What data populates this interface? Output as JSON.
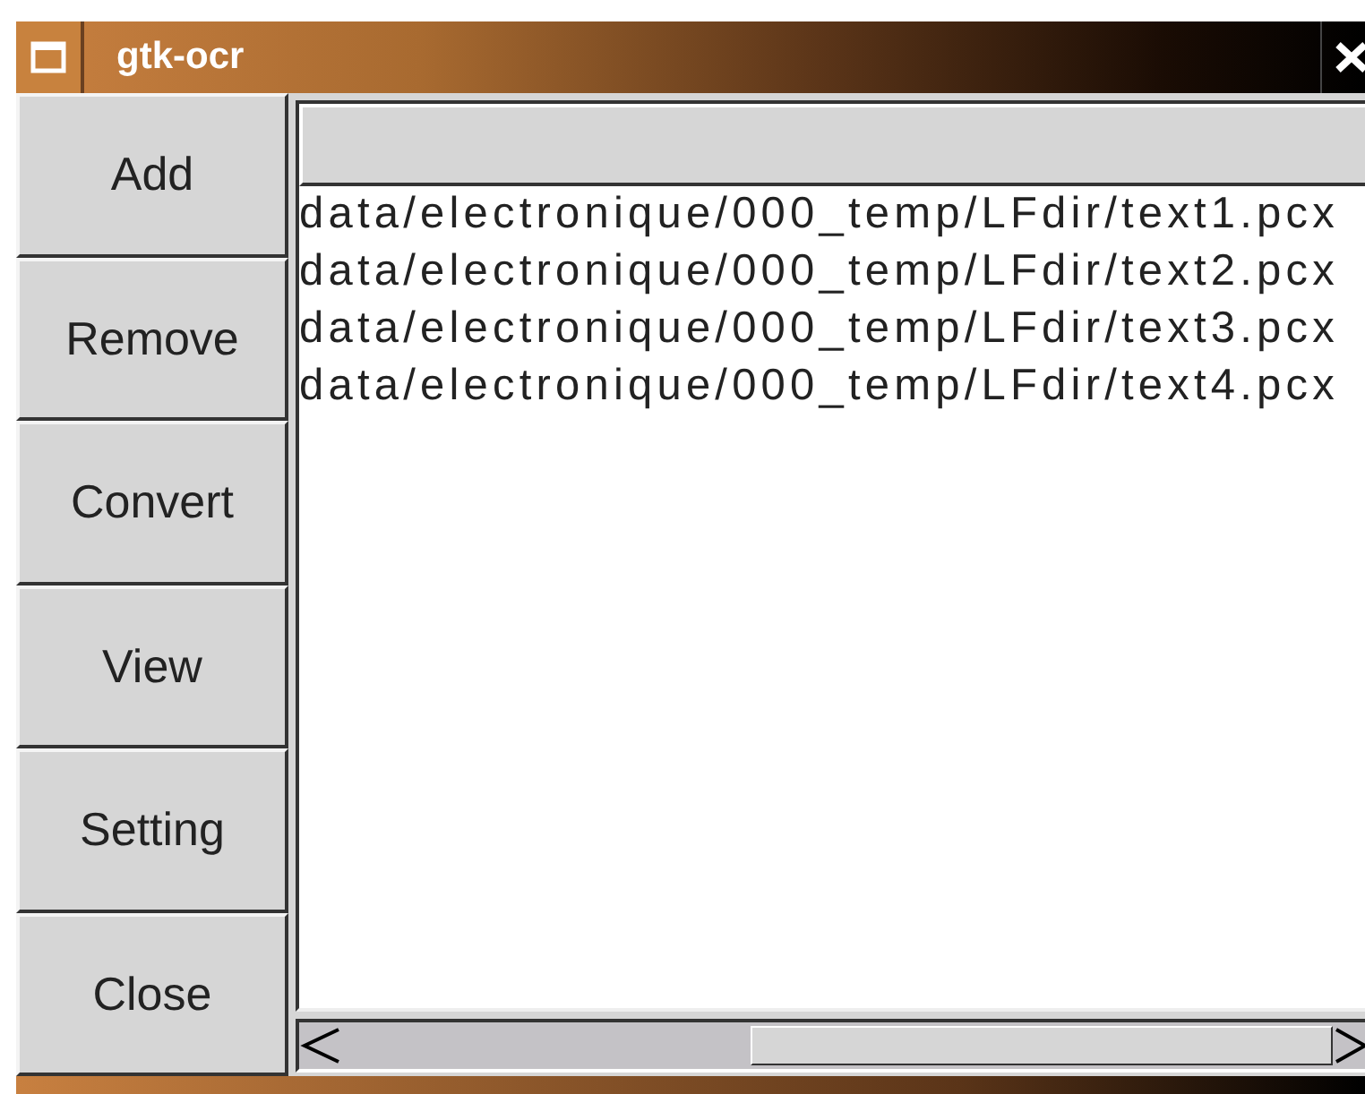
{
  "window": {
    "title": "gtk-ocr"
  },
  "buttons": [
    "Add",
    "Remove",
    "Convert",
    "View",
    "Setting",
    "Close"
  ],
  "file_list": {
    "rows": [
      "data/electronique/000_temp/LFdir/text1.pcx",
      "data/electronique/000_temp/LFdir/text2.pcx",
      "data/electronique/000_temp/LFdir/text3.pcx",
      "data/electronique/000_temp/LFdir/text4.pcx"
    ]
  }
}
